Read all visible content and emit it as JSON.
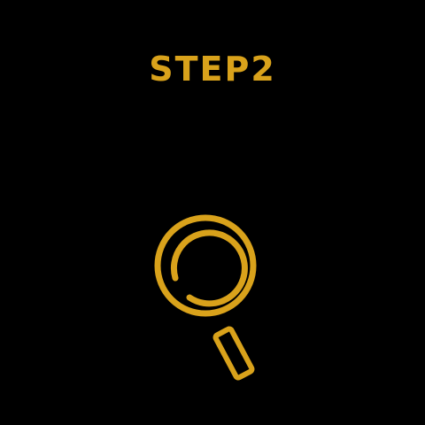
{
  "title": "STEP2",
  "icon": "magnifying-glass-icon",
  "colors": {
    "background": "#000000",
    "accent": "#D9A21B"
  }
}
